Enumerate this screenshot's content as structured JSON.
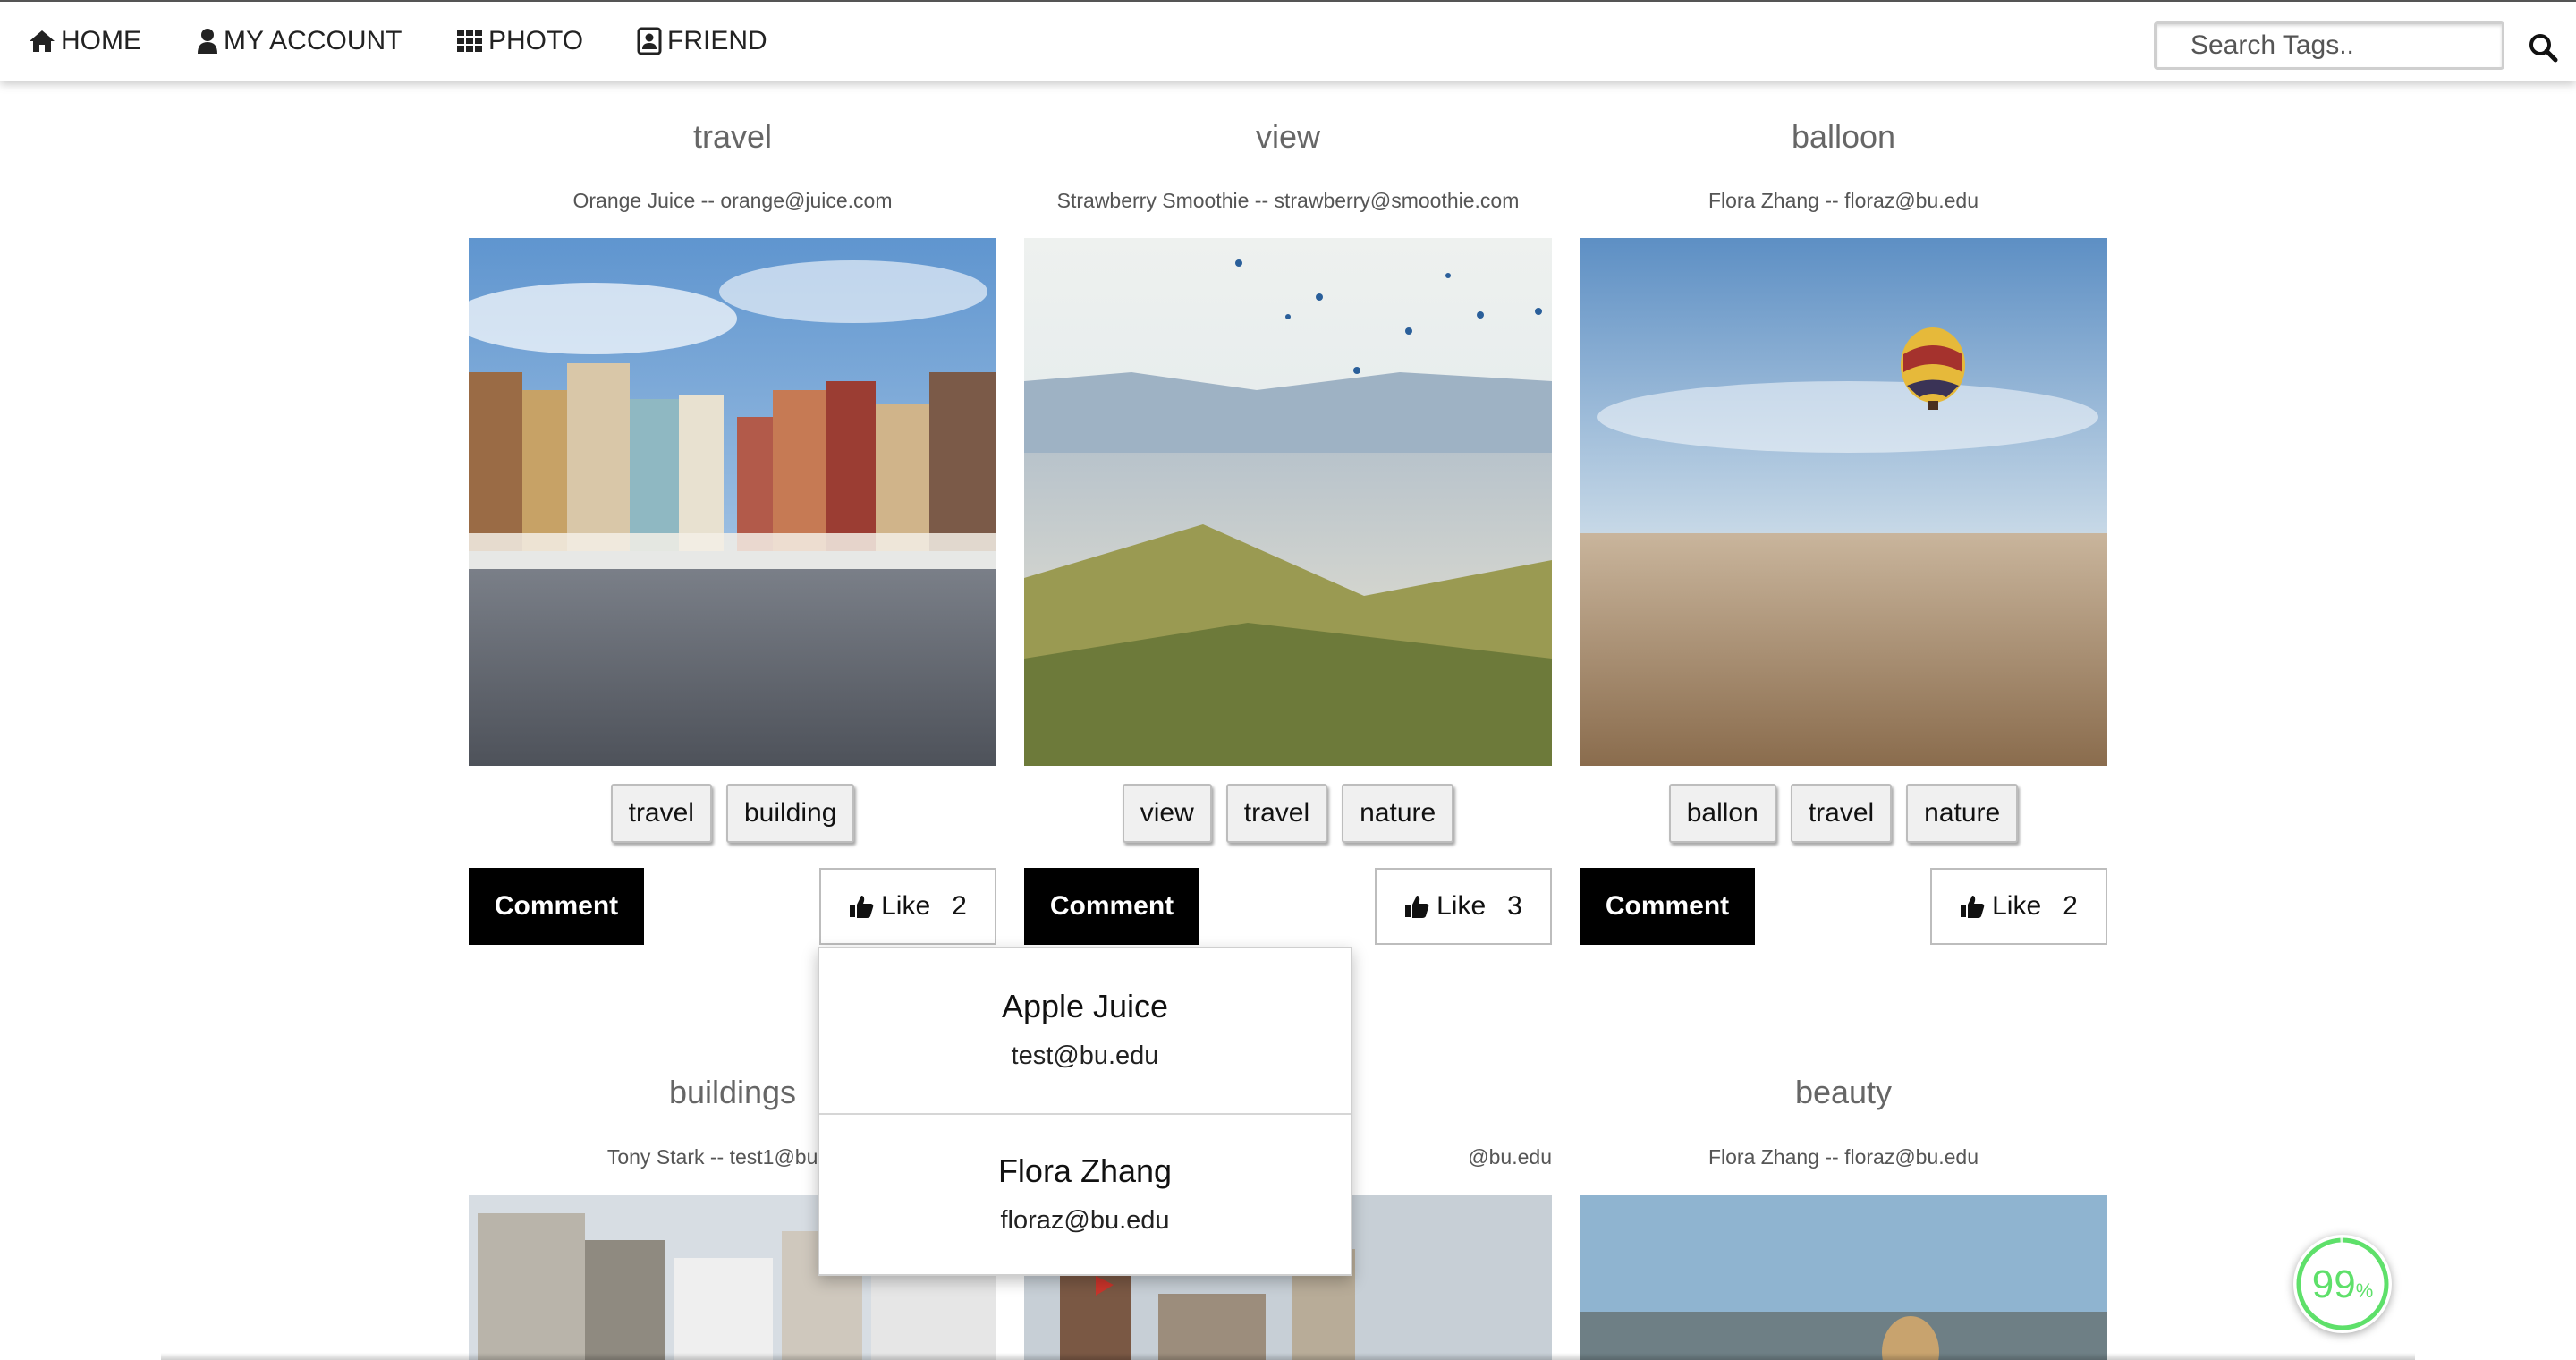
{
  "nav": {
    "home": "HOME",
    "account": "MY ACCOUNT",
    "photo": "PHOTO",
    "friend": "FRIEND",
    "search_placeholder": "Search Tags.."
  },
  "cards": [
    {
      "title": "travel",
      "owner": "Orange Juice -- orange@juice.com",
      "tags": [
        "travel",
        "building"
      ],
      "comment_label": "Comment",
      "like_label": "Like",
      "likes": "2"
    },
    {
      "title": "view",
      "owner": "Strawberry Smoothie -- strawberry@smoothie.com",
      "tags": [
        "view",
        "travel",
        "nature"
      ],
      "comment_label": "Comment",
      "like_label": "Like",
      "likes": "3"
    },
    {
      "title": "balloon",
      "owner": "Flora Zhang -- floraz@bu.edu",
      "tags": [
        "ballon",
        "travel",
        "nature"
      ],
      "comment_label": "Comment",
      "like_label": "Like",
      "likes": "2"
    },
    {
      "title": "buildings",
      "owner": "Tony Stark -- test1@bu.edu"
    },
    {
      "title": "",
      "owner": "@bu.edu"
    },
    {
      "title": "beauty",
      "owner": "Flora Zhang -- floraz@bu.edu"
    }
  ],
  "likers_popup": {
    "likers": [
      {
        "name": "Apple Juice",
        "email": "test@bu.edu"
      },
      {
        "name": "Flora Zhang",
        "email": "floraz@bu.edu"
      }
    ]
  },
  "progress_badge": {
    "value": "99",
    "unit": "%",
    "color": "#5ee06a"
  }
}
